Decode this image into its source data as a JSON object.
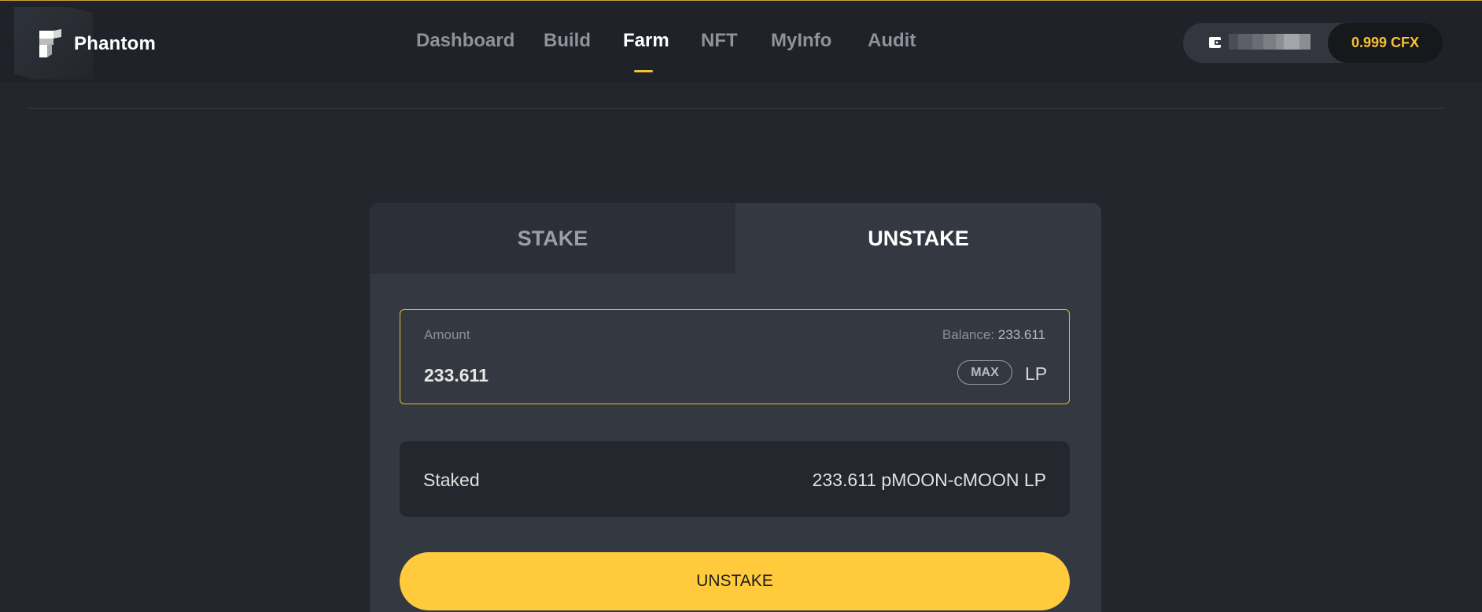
{
  "app": {
    "name": "Phantom"
  },
  "nav": {
    "items": [
      {
        "label": "Dashboard"
      },
      {
        "label": "Build"
      },
      {
        "label": "Farm"
      },
      {
        "label": "NFT"
      },
      {
        "label": "MyInfo"
      },
      {
        "label": "Audit"
      }
    ],
    "active": "Farm"
  },
  "wallet": {
    "balance": "0.999 CFX"
  },
  "tabs": {
    "stake": "STAKE",
    "unstake": "UNSTAKE",
    "active": "UNSTAKE"
  },
  "amount": {
    "label": "Amount",
    "balance_prefix": "Balance: ",
    "balance_value": "233.611",
    "value": "233.611",
    "max_label": "MAX",
    "unit": "LP"
  },
  "staked": {
    "label": "Staked",
    "value": "233.611 pMOON-cMOON LP"
  },
  "action": {
    "label": "UNSTAKE"
  },
  "colors": {
    "accent": "#ffcb3d",
    "background": "#23262d",
    "header": "#1f2228",
    "card": "#343841"
  },
  "icons": {
    "logo": "phantom-logo-icon",
    "wallet": "wallet-icon"
  }
}
